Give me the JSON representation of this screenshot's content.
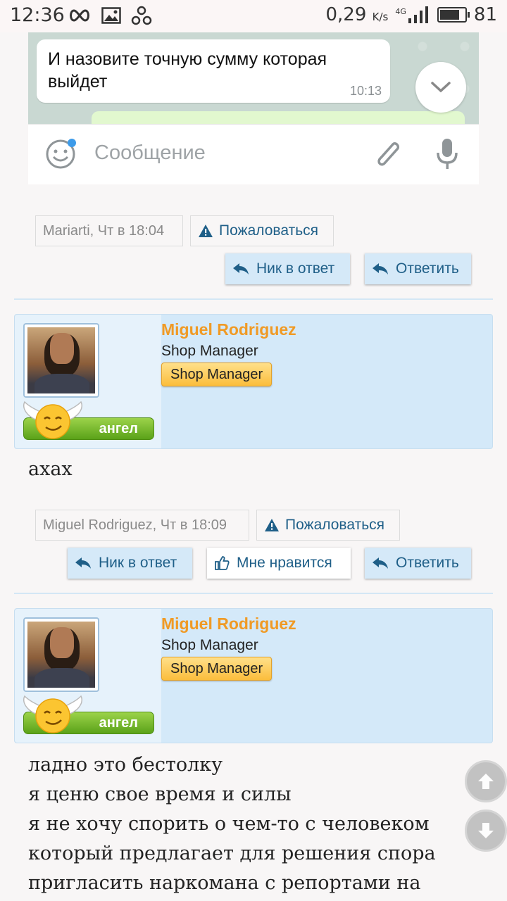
{
  "status_bar": {
    "time": "12:36",
    "speed_value": "0,29",
    "speed_unit": "K/s",
    "network": "4G",
    "battery": "81",
    "battery_level": 0.81
  },
  "embed": {
    "message_text": "И назовите точную сумму которая выйдет",
    "message_time": "10:13",
    "input_placeholder": "Сообщение"
  },
  "posts": [
    {
      "meta_author": "Mariarti",
      "meta_time": ", Чт в 18:04",
      "report_label": "Пожаловаться",
      "reply_nick_label": "Ник в ответ",
      "reply_label": "Ответить"
    },
    {
      "author": "Miguel Rodriguez",
      "title": "Shop Manager",
      "badge": "Shop Manager",
      "rank": "ангел",
      "text": "ахах",
      "meta_author": "Miguel Rodriguez",
      "meta_time": ", Чт в 18:09",
      "report_label": "Пожаловаться",
      "reply_nick_label": "Ник в ответ",
      "like_label": "Мне нравится",
      "reply_label": "Ответить"
    },
    {
      "author": "Miguel Rodriguez",
      "title": "Shop Manager",
      "badge": "Shop Manager",
      "rank": "ангел",
      "text_lines": [
        "ладно это бестолку",
        "я ценю свое время и силы",
        "я не хочу спорить о чем-то с человеком",
        "который предлагает для решения спора",
        "пригласить наркомана с репортами на"
      ]
    }
  ],
  "colors": {
    "accent_blue": "#1f5f88",
    "author_orange": "#f09a25",
    "panel_blue": "#d4e9f9"
  }
}
